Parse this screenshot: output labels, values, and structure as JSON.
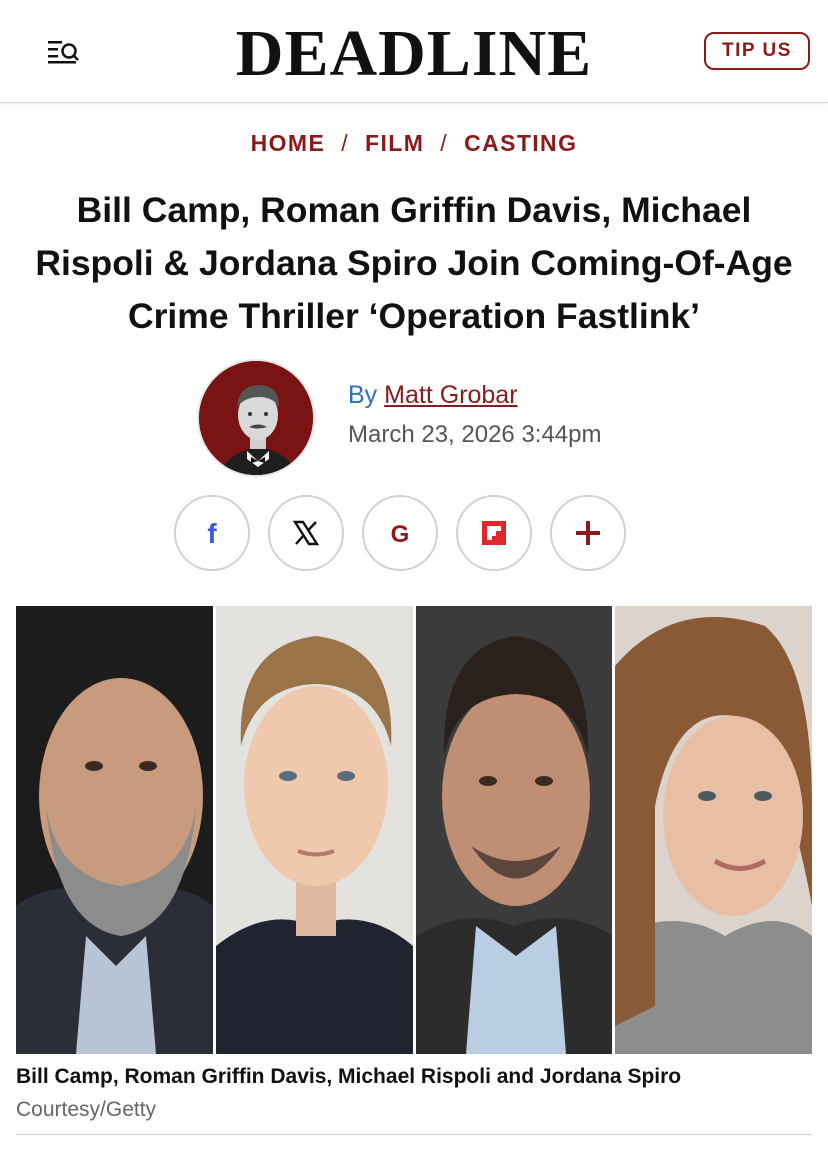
{
  "header": {
    "logo_text": "DEADLINE",
    "tip_label": "TIP US",
    "menu_icon": "menu-search-icon"
  },
  "breadcrumb": {
    "items": [
      "HOME",
      "FILM",
      "CASTING"
    ],
    "separator": "/"
  },
  "article": {
    "title": "Bill Camp, Roman Griffin Davis, Michael Rispoli & Jordana Spiro Join Coming-Of-Age Crime Thriller ‘Operation Fastlink’",
    "by_label": "By",
    "author": "Matt Grobar",
    "date": "March 23, 2026 3:44pm"
  },
  "share": [
    {
      "name": "facebook-share-button",
      "icon": "facebook-icon",
      "color": "#3b5bdb"
    },
    {
      "name": "x-share-button",
      "icon": "x-icon",
      "color": "#111111"
    },
    {
      "name": "google-share-button",
      "icon": "google-icon",
      "color": "#8b1a1a"
    },
    {
      "name": "flipboard-share-button",
      "icon": "flipboard-icon",
      "color": "#e12828"
    },
    {
      "name": "more-share-button",
      "icon": "plus-icon",
      "color": "#8b1a1a"
    }
  ],
  "image": {
    "caption": "Bill Camp, Roman Griffin Davis, Michael Rispoli and Jordana Spiro",
    "credit": "Courtesy/Getty"
  },
  "colors": {
    "accent": "#8b1a1a",
    "link_blue": "#2f6fbf"
  }
}
